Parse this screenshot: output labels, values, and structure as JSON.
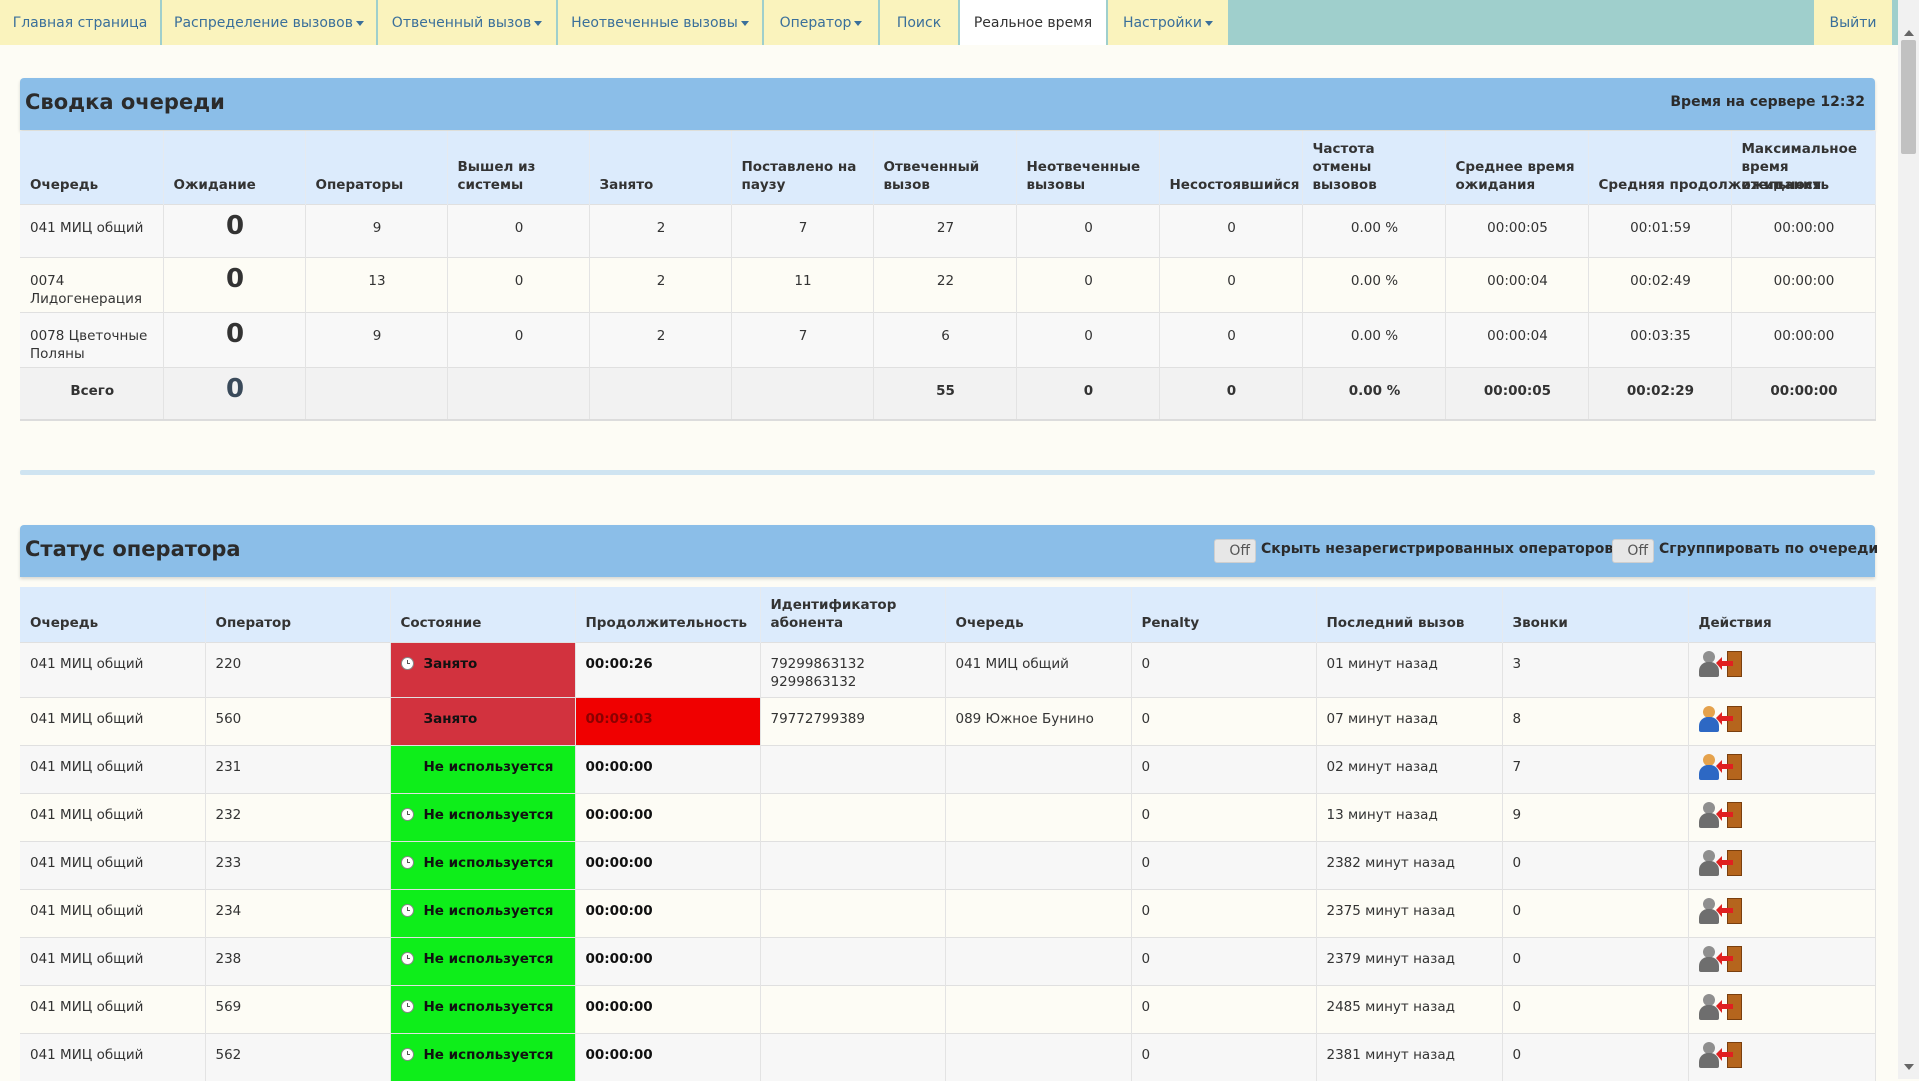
{
  "nav": {
    "tabs": [
      {
        "label": "Главная страница",
        "dropdown": false
      },
      {
        "label": "Распределение вызовов",
        "dropdown": true
      },
      {
        "label": "Отвеченный вызов",
        "dropdown": true
      },
      {
        "label": "Неотвеченные вызовы",
        "dropdown": true
      },
      {
        "label": "Оператор",
        "dropdown": true
      },
      {
        "label": "Поиск",
        "dropdown": false
      },
      {
        "label": "Реальное время",
        "dropdown": false,
        "active": true
      },
      {
        "label": "Настройки",
        "dropdown": true
      }
    ],
    "logout": "Выйти"
  },
  "queue_summary": {
    "title": "Сводка очереди",
    "server_time": "Время на сервере 12:32",
    "columns": [
      "Очередь",
      "Ожидание",
      "Операторы",
      "Вышел из системы",
      "Занято",
      "Поставлено на паузу",
      "Отвеченный вызов",
      "Неотвеченные вызовы",
      "Несостоявшийся",
      "Частота отмены вызовов",
      "Среднее время ожидания",
      "Средняя продолжительность",
      "Максимальное время ожидания"
    ],
    "rows": [
      {
        "queue": "041 МИЦ общий",
        "waiting": "0",
        "agents": "9",
        "logged_out": "0",
        "busy": "2",
        "paused": "7",
        "answered": "27",
        "unanswered": "0",
        "failed": "0",
        "abandon_rate": "0.00 %",
        "avg_wait": "00:00:05",
        "avg_duration": "00:01:59",
        "max_wait": "00:00:00"
      },
      {
        "queue": "0074 Лидогенерация",
        "waiting": "0",
        "agents": "13",
        "logged_out": "0",
        "busy": "2",
        "paused": "11",
        "answered": "22",
        "unanswered": "0",
        "failed": "0",
        "abandon_rate": "0.00 %",
        "avg_wait": "00:00:04",
        "avg_duration": "00:02:49",
        "max_wait": "00:00:00"
      },
      {
        "queue": "0078 Цветочные Поляны",
        "waiting": "0",
        "agents": "9",
        "logged_out": "0",
        "busy": "2",
        "paused": "7",
        "answered": "6",
        "unanswered": "0",
        "failed": "0",
        "abandon_rate": "0.00 %",
        "avg_wait": "00:00:04",
        "avg_duration": "00:03:35",
        "max_wait": "00:00:00"
      }
    ],
    "total": {
      "label": "Всего",
      "waiting": "0",
      "answered": "55",
      "unanswered": "0",
      "failed": "0",
      "abandon_rate": "0.00 %",
      "avg_wait": "00:00:05",
      "avg_duration": "00:02:29",
      "max_wait": "00:00:00"
    }
  },
  "agent_status": {
    "title": "Статус оператора",
    "toggle_hide": {
      "state": "Off",
      "label": "Скрыть незарегистрированных операторов"
    },
    "toggle_group": {
      "state": "Off",
      "label": "Сгруппировать по очереди"
    },
    "columns": [
      "Очередь",
      "Оператор",
      "Состояние",
      "Продолжительность",
      "Идентификатор абонента",
      "Очередь",
      "Penalty",
      "Последний вызов",
      "Звонки",
      "Действия"
    ],
    "rows": [
      {
        "queue": "041 МИЦ общий",
        "agent": "220",
        "state": "Занято",
        "state_type": "busy",
        "clock": true,
        "duration": "00:00:26",
        "duration_alert": false,
        "caller_id_1": "79299863132",
        "caller_id_2": "9299863132",
        "call_queue": "041 МИЦ общий",
        "penalty": "0",
        "last_call": "01 минут назад",
        "calls": "3",
        "agent_icon_active": false
      },
      {
        "queue": "041 МИЦ общий",
        "agent": "560",
        "state": "Занято",
        "state_type": "busy",
        "clock": false,
        "duration": "00:09:03",
        "duration_alert": true,
        "caller_id_1": "79772799389",
        "caller_id_2": "",
        "call_queue": "089 Южное Бунино",
        "penalty": "0",
        "last_call": "07 минут назад",
        "calls": "8",
        "agent_icon_active": true
      },
      {
        "queue": "041 МИЦ общий",
        "agent": "231",
        "state": "Не используется",
        "state_type": "free",
        "clock": false,
        "duration": "00:00:00",
        "duration_alert": false,
        "caller_id_1": "",
        "caller_id_2": "",
        "call_queue": "",
        "penalty": "0",
        "last_call": "02 минут назад",
        "calls": "7",
        "agent_icon_active": true
      },
      {
        "queue": "041 МИЦ общий",
        "agent": "232",
        "state": "Не используется",
        "state_type": "free",
        "clock": true,
        "duration": "00:00:00",
        "duration_alert": false,
        "caller_id_1": "",
        "caller_id_2": "",
        "call_queue": "",
        "penalty": "0",
        "last_call": "13 минут назад",
        "calls": "9",
        "agent_icon_active": false
      },
      {
        "queue": "041 МИЦ общий",
        "agent": "233",
        "state": "Не используется",
        "state_type": "free",
        "clock": true,
        "duration": "00:00:00",
        "duration_alert": false,
        "caller_id_1": "",
        "caller_id_2": "",
        "call_queue": "",
        "penalty": "0",
        "last_call": "2382 минут назад",
        "calls": "0",
        "agent_icon_active": false
      },
      {
        "queue": "041 МИЦ общий",
        "agent": "234",
        "state": "Не используется",
        "state_type": "free",
        "clock": true,
        "duration": "00:00:00",
        "duration_alert": false,
        "caller_id_1": "",
        "caller_id_2": "",
        "call_queue": "",
        "penalty": "0",
        "last_call": "2375 минут назад",
        "calls": "0",
        "agent_icon_active": false
      },
      {
        "queue": "041 МИЦ общий",
        "agent": "238",
        "state": "Не используется",
        "state_type": "free",
        "clock": true,
        "duration": "00:00:00",
        "duration_alert": false,
        "caller_id_1": "",
        "caller_id_2": "",
        "call_queue": "",
        "penalty": "0",
        "last_call": "2379 минут назад",
        "calls": "0",
        "agent_icon_active": false
      },
      {
        "queue": "041 МИЦ общий",
        "agent": "569",
        "state": "Не используется",
        "state_type": "free",
        "clock": true,
        "duration": "00:00:00",
        "duration_alert": false,
        "caller_id_1": "",
        "caller_id_2": "",
        "call_queue": "",
        "penalty": "0",
        "last_call": "2485 минут назад",
        "calls": "0",
        "agent_icon_active": false
      },
      {
        "queue": "041 МИЦ общий",
        "agent": "562",
        "state": "Не используется",
        "state_type": "free",
        "clock": true,
        "duration": "00:00:00",
        "duration_alert": false,
        "caller_id_1": "",
        "caller_id_2": "",
        "call_queue": "",
        "penalty": "0",
        "last_call": "2381 минут назад",
        "calls": "0",
        "agent_icon_active": false
      }
    ]
  }
}
